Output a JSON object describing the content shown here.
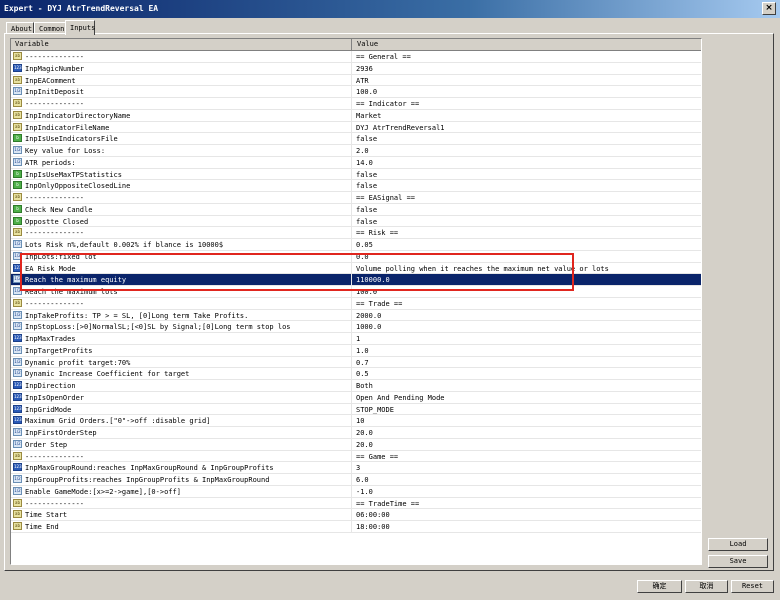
{
  "window": {
    "title": "Expert - DYJ AtrTrendReversal EA",
    "close": "×"
  },
  "tabs": [
    {
      "label": "About"
    },
    {
      "label": "Common"
    },
    {
      "label": "Inputs"
    }
  ],
  "grid": {
    "col_variable": "Variable",
    "col_value": "Value",
    "rows": [
      {
        "icon": "ab",
        "name": "--------------",
        "value": "== General =="
      },
      {
        "icon": "123",
        "name": "InpMagicNumber",
        "value": "2936"
      },
      {
        "icon": "ab",
        "name": "InpEAComment",
        "value": "ATR"
      },
      {
        "icon": "1/2",
        "name": "InpInitDeposit",
        "value": "100.0"
      },
      {
        "icon": "ab",
        "name": "--------------",
        "value": "== Indicator =="
      },
      {
        "icon": "ab",
        "name": "InpIndicatorDirectoryName",
        "value": "Market"
      },
      {
        "icon": "ab",
        "name": "InpIndicatorFileName",
        "value": "DYJ AtrTrendReversal1"
      },
      {
        "icon": "b",
        "name": "InpIsUseIndicatorsFile",
        "value": "false"
      },
      {
        "icon": "1/2",
        "name": "Key value for Loss:",
        "value": "2.0"
      },
      {
        "icon": "1/2",
        "name": "ATR periods:",
        "value": "14.0"
      },
      {
        "icon": "b",
        "name": "InpIsUseMaxTPStatistics",
        "value": "false"
      },
      {
        "icon": "b",
        "name": "InpOnlyOppositeClosedLine",
        "value": "false"
      },
      {
        "icon": "ab",
        "name": "--------------",
        "value": "== EASignal =="
      },
      {
        "icon": "b",
        "name": "Check New Candle",
        "value": "false"
      },
      {
        "icon": "b",
        "name": "Oppostte Closed",
        "value": "false"
      },
      {
        "icon": "ab",
        "name": "--------------",
        "value": "== Risk =="
      },
      {
        "icon": "1/2",
        "name": "Lots Risk n%,default 0.002% if blance is 10000$",
        "value": "0.05"
      },
      {
        "icon": "1/2",
        "name": "InpLots:fixed lot",
        "value": "0.0"
      },
      {
        "icon": "123",
        "name": "EA Risk Mode",
        "value": "Volume polling when it reaches the maximum net value or lots"
      },
      {
        "icon": "1/2",
        "name": "Reach the maximum equity",
        "value": "110000.0",
        "selected": true
      },
      {
        "icon": "1/2",
        "name": "Reach the maximum lots",
        "value": "100.0"
      },
      {
        "icon": "ab",
        "name": "--------------",
        "value": "== Trade =="
      },
      {
        "icon": "1/2",
        "name": "InpTakeProfits: TP > = SL, [0]Long term Take Profits.",
        "value": "2000.0"
      },
      {
        "icon": "1/2",
        "name": "InpStopLoss:[>0]NormalSL;[<0]SL by Signal;[0]Long term stop los",
        "value": "1000.0"
      },
      {
        "icon": "123",
        "name": "InpMaxTrades",
        "value": "1"
      },
      {
        "icon": "1/2",
        "name": "InpTargetProfits",
        "value": "1.0"
      },
      {
        "icon": "1/2",
        "name": "Dynamic profit target:70%",
        "value": "0.7"
      },
      {
        "icon": "1/2",
        "name": "Dynamic Increase Coefficient for target",
        "value": "0.5"
      },
      {
        "icon": "123",
        "name": "InpDirection",
        "value": "Both"
      },
      {
        "icon": "123",
        "name": "InpIsOpenOrder",
        "value": "Open And Pending Mode"
      },
      {
        "icon": "123",
        "name": "InpGridMode",
        "value": "STOP_MODE"
      },
      {
        "icon": "123",
        "name": "Maximum Grid Orders.[\"0\"->off :disable grid]",
        "value": "10"
      },
      {
        "icon": "1/2",
        "name": "InpFirstOrderStep",
        "value": "20.0"
      },
      {
        "icon": "1/2",
        "name": "Order Step",
        "value": "20.0"
      },
      {
        "icon": "ab",
        "name": "--------------",
        "value": "== Game =="
      },
      {
        "icon": "123",
        "name": "InpMaxGroupRound:reaches InpMaxGroupRound & InpGroupProfits",
        "value": "3"
      },
      {
        "icon": "1/2",
        "name": "InpGroupProfits:reaches InpGroupProfits & InpMaxGroupRound",
        "value": "6.0"
      },
      {
        "icon": "1/2",
        "name": "Enable GameMode:[x>=2->game],[0->off]",
        "value": "-1.0"
      },
      {
        "icon": "ab",
        "name": "--------------",
        "value": "== TradeTime =="
      },
      {
        "icon": "ab",
        "name": "Time Start",
        "value": "06:00:00"
      },
      {
        "icon": "ab",
        "name": "Time End",
        "value": "18:00:00"
      }
    ]
  },
  "side_buttons": {
    "load": "Load",
    "save": "Save"
  },
  "bottom_buttons": {
    "ok": "确定",
    "cancel": "取消",
    "reset": "Reset"
  }
}
